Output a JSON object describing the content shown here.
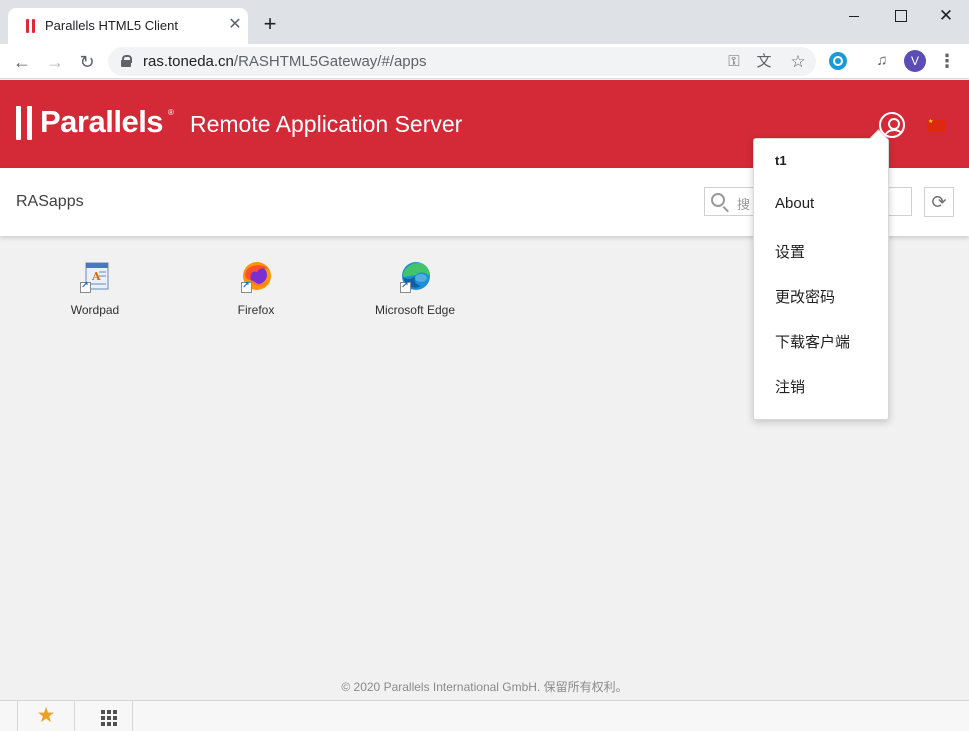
{
  "browser": {
    "tab_title": "Parallels HTML5 Client",
    "tab_close": "✕",
    "new_tab": "+",
    "url_host": "ras.toneda.cn",
    "url_path": "/RASHTML5Gateway/#/apps",
    "profile_initial": "V",
    "window_controls": {
      "close": "✕"
    }
  },
  "header": {
    "logo_text": "Parallels",
    "logo_reg": "®",
    "product_name": "Remote Application Server"
  },
  "subheader": {
    "title": "RASapps",
    "search_placeholder": "搜"
  },
  "apps": [
    {
      "label": "Wordpad",
      "icon": "wordpad-icon"
    },
    {
      "label": "Firefox",
      "icon": "firefox-icon"
    },
    {
      "label": "Microsoft Edge",
      "icon": "edge-icon"
    }
  ],
  "user_menu": {
    "username": "t1",
    "items": [
      "About",
      "设置",
      "更改密码",
      "下载客户端",
      "注销"
    ]
  },
  "footer": {
    "copyright": "© 2020 Parallels International GmbH. 保留所有权利。"
  },
  "colors": {
    "brand_red": "#d42a37",
    "background": "#f1f1f1"
  }
}
